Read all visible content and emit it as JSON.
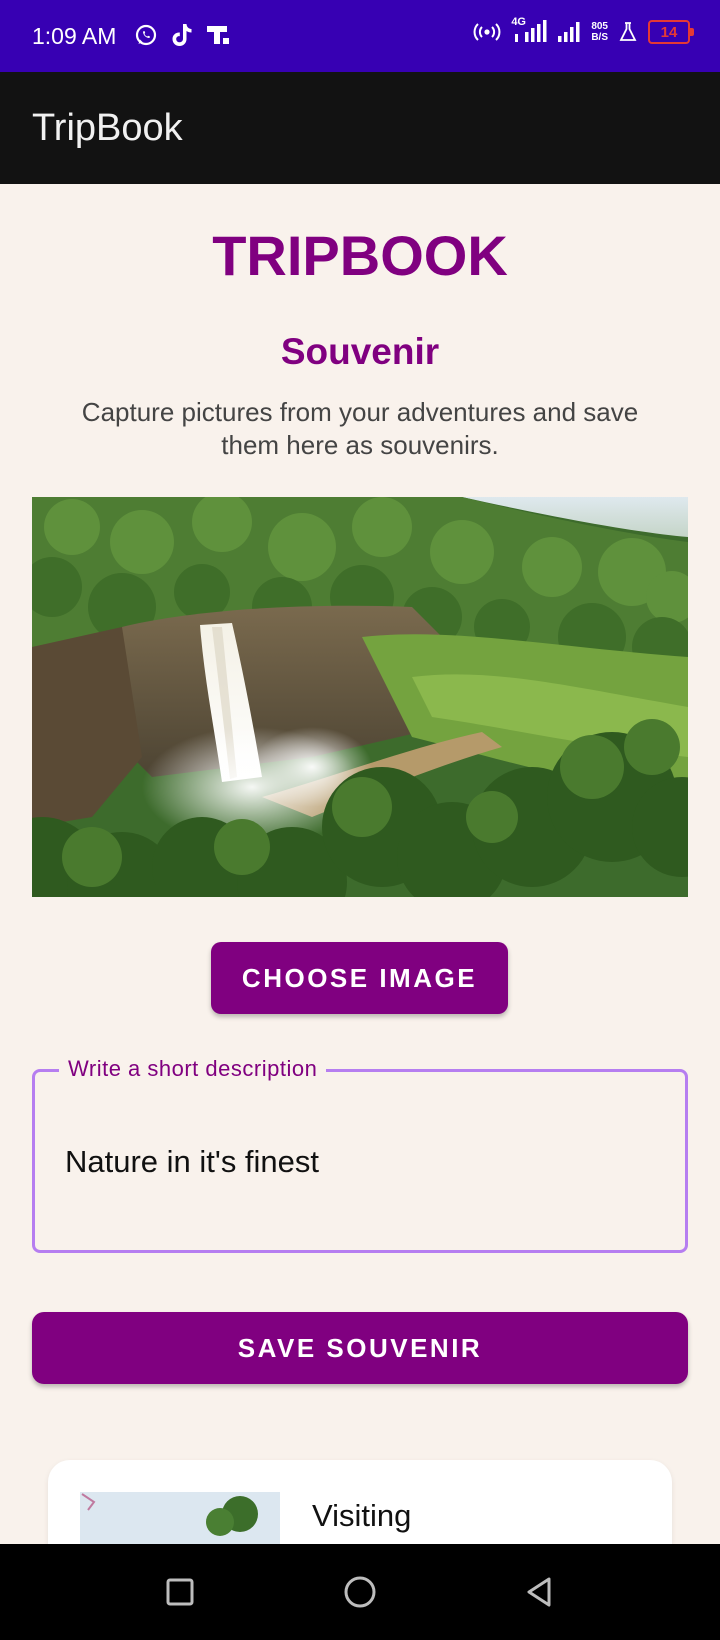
{
  "status_bar": {
    "time": "1:09 AM",
    "net_speed_value": "805",
    "net_speed_unit": "B/S",
    "network_label": "4G",
    "battery": "14",
    "icons": [
      "whatsapp-icon",
      "tiktok-icon",
      "t-app-icon",
      "hotspot-icon",
      "signal-icon",
      "signal-icon",
      "lab-icon",
      "battery-icon"
    ]
  },
  "app_bar": {
    "title": "TripBook"
  },
  "main": {
    "headline": "TRIPBOOK",
    "subhead": "Souvenir",
    "intro": "Capture pictures from your adventures and save them here as souvenirs.",
    "choose_label": "CHOOSE IMAGE",
    "description": {
      "label": "Write a short description",
      "value": "Nature in it's finest"
    },
    "save_label": "SAVE SOUVENIR"
  },
  "souvenirs": [
    {
      "title": "Visiting"
    }
  ],
  "colors": {
    "status_bar": "#3700b3",
    "app_bar": "#121212",
    "background": "#f9f2ec",
    "accent": "#800080",
    "field_border": "#b67ef0",
    "battery": "#e53935"
  },
  "nav": {
    "icons": [
      "recent-apps-icon",
      "home-icon",
      "back-icon"
    ]
  }
}
